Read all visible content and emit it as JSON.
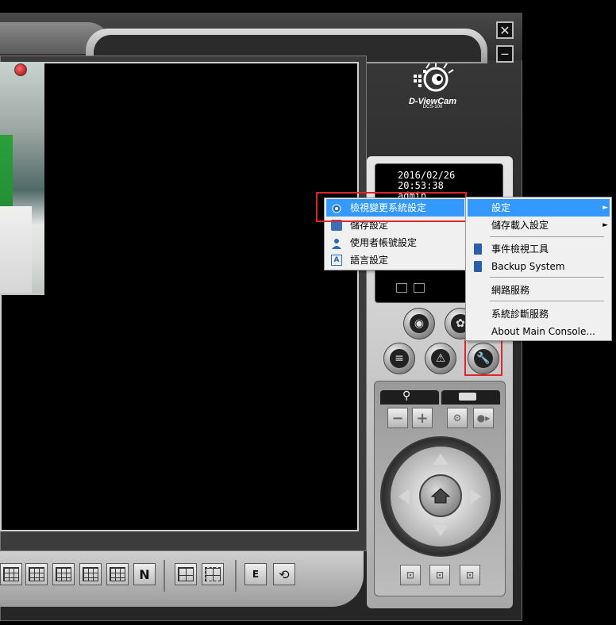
{
  "window": {
    "close_glyph": "✕",
    "minimize_glyph": "—"
  },
  "logo": {
    "brand": "D-ViewCam",
    "model": "DCS-100"
  },
  "info_screen": {
    "date": "2016/02/26",
    "time": "20:53:38",
    "status_text": "admin"
  },
  "bottom_toolbar": {
    "n_button": "N",
    "e_button": "E"
  },
  "left_menu": {
    "items": [
      {
        "label": "檢視變更系統設定",
        "icon": "gear-icon",
        "highlighted": true
      },
      {
        "label": "儲存設定",
        "icon": "save-icon",
        "highlighted": false
      },
      {
        "label": "使用者帳號設定",
        "icon": "user-icon",
        "highlighted": false
      },
      {
        "label": "語言設定",
        "icon": "language-icon",
        "highlighted": false
      }
    ]
  },
  "right_menu": {
    "items": [
      {
        "label": "設定",
        "submenu": true,
        "highlighted": true
      },
      {
        "label": "儲存載入設定",
        "submenu": true
      },
      {
        "label": "事件檢視工具",
        "icon": "event-log-icon"
      },
      {
        "label": "Backup System",
        "icon": "backup-icon"
      },
      {
        "label": "網路服務"
      },
      {
        "label": "系統診斷服務"
      },
      {
        "label": "About Main Console..."
      }
    ],
    "submenu_arrow": "►"
  },
  "colors": {
    "highlight": "#3399ff",
    "annotation_red": "#e0242b",
    "menu_bg": "#f0f0f0"
  }
}
